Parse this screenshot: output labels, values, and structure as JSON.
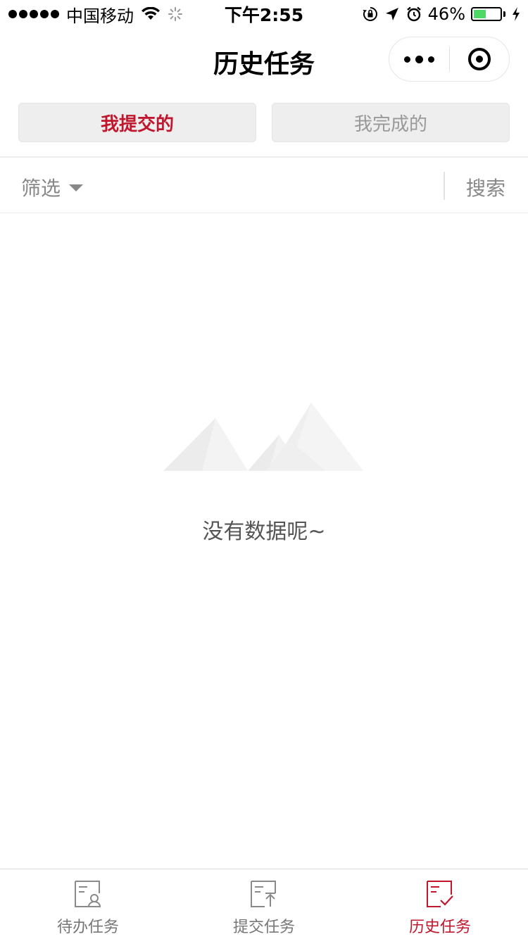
{
  "status_bar": {
    "carrier": "中国移动",
    "time": "下午2:55",
    "battery_percent": "46%",
    "battery_level": 0.46
  },
  "nav": {
    "title": "历史任务"
  },
  "tabs": [
    {
      "label": "我提交的",
      "active": true
    },
    {
      "label": "我完成的",
      "active": false
    }
  ],
  "filter_bar": {
    "filter_label": "筛选",
    "search_label": "搜索"
  },
  "empty_state": {
    "message": "没有数据呢~",
    "icon": "mountains-icon"
  },
  "tab_bar": [
    {
      "label": "待办任务",
      "icon": "todo-task-icon",
      "active": false
    },
    {
      "label": "提交任务",
      "icon": "submit-task-icon",
      "active": false
    },
    {
      "label": "历史任务",
      "icon": "history-task-icon",
      "active": true
    }
  ],
  "colors": {
    "accent": "#c0172e",
    "battery": "#4cd964",
    "tab_bg": "#eeeeee",
    "inactive_text": "#999999"
  }
}
